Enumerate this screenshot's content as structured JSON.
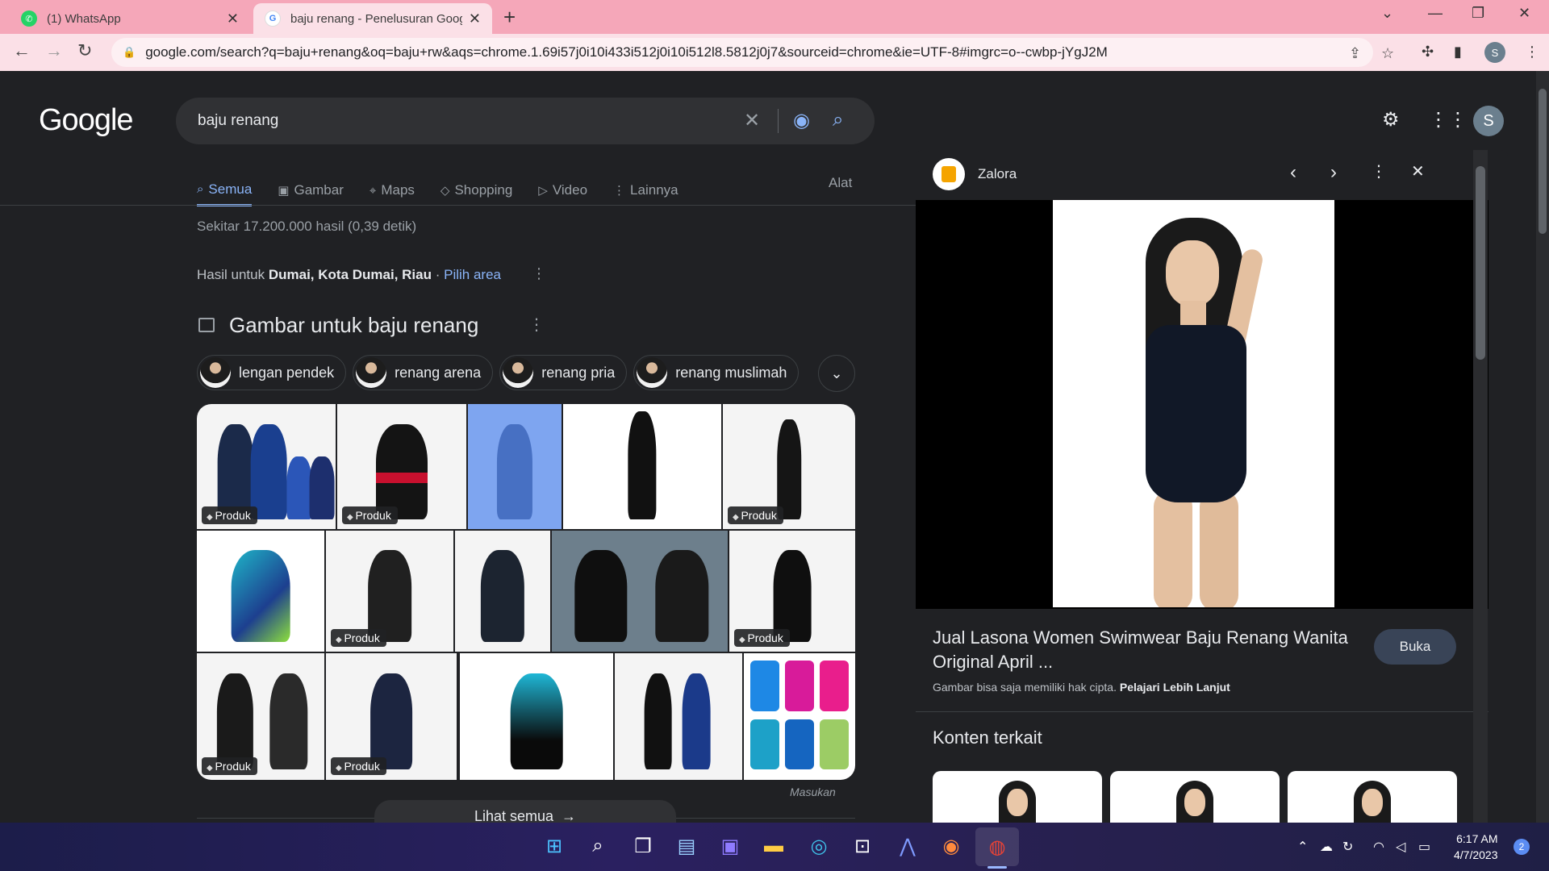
{
  "browser": {
    "tabs": [
      {
        "title": "(1) WhatsApp",
        "icon": "whatsapp-icon"
      },
      {
        "title": "baju renang - Penelusuran Googl",
        "icon": "google-icon"
      }
    ],
    "url": "google.com/search?q=baju+renang&oq=baju+rw&aqs=chrome.1.69i57j0i10i433i512j0i10i512l8.5812j0j7&sourceid=chrome&ie=UTF-8#imgrc=o--cwbp-jYgJ2M",
    "profile_initial": "S",
    "theme_color": "#f5a7b9"
  },
  "google": {
    "logo": "Google",
    "query": "baju renang",
    "avatar_initial": "S",
    "tabs": [
      {
        "label": "Semua",
        "icon": "search-icon"
      },
      {
        "label": "Gambar",
        "icon": "image-icon"
      },
      {
        "label": "Maps",
        "icon": "map-pin-icon"
      },
      {
        "label": "Shopping",
        "icon": "tag-icon"
      },
      {
        "label": "Video",
        "icon": "play-icon"
      },
      {
        "label": "Lainnya",
        "icon": "more-vert-icon"
      }
    ],
    "tools_label": "Alat",
    "stats": "Sekitar 17.200.000 hasil (0,39 detik)",
    "location": {
      "prefix": "Hasil untuk",
      "place": "Dumai, Kota Dumai, Riau",
      "separator": "·",
      "change_link": "Pilih area"
    },
    "images_section": {
      "title": "Gambar untuk baju renang",
      "chips": [
        "lengan pendek",
        "renang arena",
        "renang pria",
        "renang muslimah"
      ],
      "tag_label": "Produk",
      "feedback": "Masukan",
      "see_all": "Lihat semua"
    }
  },
  "panel": {
    "source": "Zalora",
    "title": "Jual Lasona Women Swimwear Baju Renang Wanita Original April ...",
    "open_button": "Buka",
    "copyright_text": "Gambar bisa saja memiliki hak cipta.",
    "learn_more": "Pelajari Lebih Lanjut",
    "related_heading": "Konten terkait"
  },
  "taskbar": {
    "time": "6:17 AM",
    "date": "4/7/2023",
    "notifications": "2"
  }
}
